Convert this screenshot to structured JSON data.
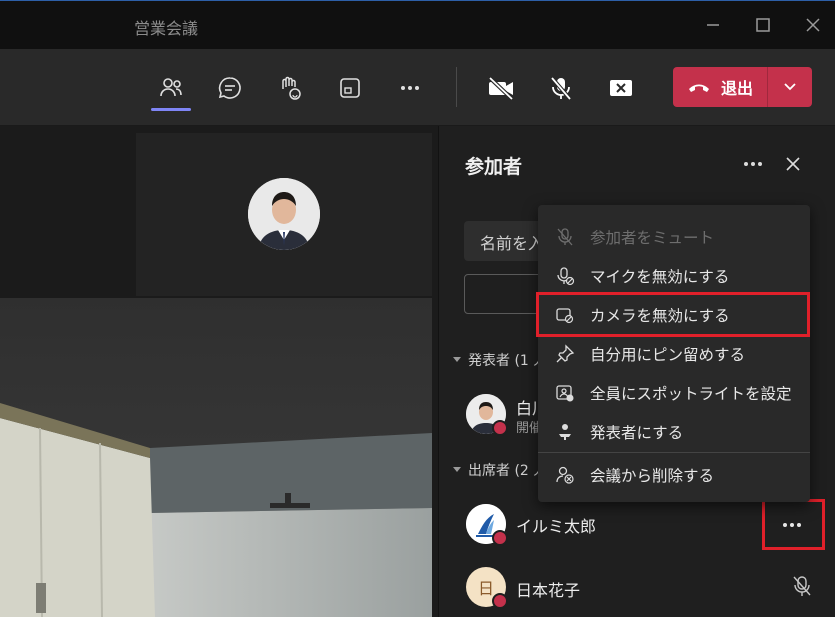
{
  "window": {
    "title": "営業会議"
  },
  "toolbar": {
    "leave_label": "退出",
    "icons": [
      "people-icon",
      "chat-icon",
      "raise-hand-icon",
      "view-icon",
      "more-icon",
      "camera-off-icon",
      "mic-off-icon",
      "share-stop-icon"
    ]
  },
  "panel": {
    "title": "参加者",
    "search_placeholder": "名前を入",
    "sections": {
      "presenters": "発表者 (1 人",
      "attendees": "出席者 (2 人"
    },
    "presenter": {
      "name": "白川",
      "status": "開催"
    },
    "attendees": [
      {
        "name": "イルミ太郎"
      },
      {
        "name": "日本花子",
        "initial": "日"
      }
    ]
  },
  "context_menu": {
    "items": [
      {
        "label": "参加者をミュート",
        "icon": "mic-off-icon",
        "disabled": true
      },
      {
        "label": "マイクを無効にする",
        "icon": "mic-disable-icon",
        "disabled": false
      },
      {
        "label": "カメラを無効にする",
        "icon": "camera-disable-icon",
        "disabled": false
      },
      {
        "label": "自分用にピン留めする",
        "icon": "pin-icon",
        "disabled": false
      },
      {
        "label": "全員にスポットライトを設定",
        "icon": "spotlight-icon",
        "disabled": false
      },
      {
        "label": "発表者にする",
        "icon": "presenter-icon",
        "disabled": false
      },
      {
        "label": "会議から削除する",
        "icon": "remove-person-icon",
        "disabled": false
      }
    ]
  },
  "colors": {
    "accent": "#7f85f5",
    "leave": "#c4314b",
    "highlight": "#e0202a"
  }
}
